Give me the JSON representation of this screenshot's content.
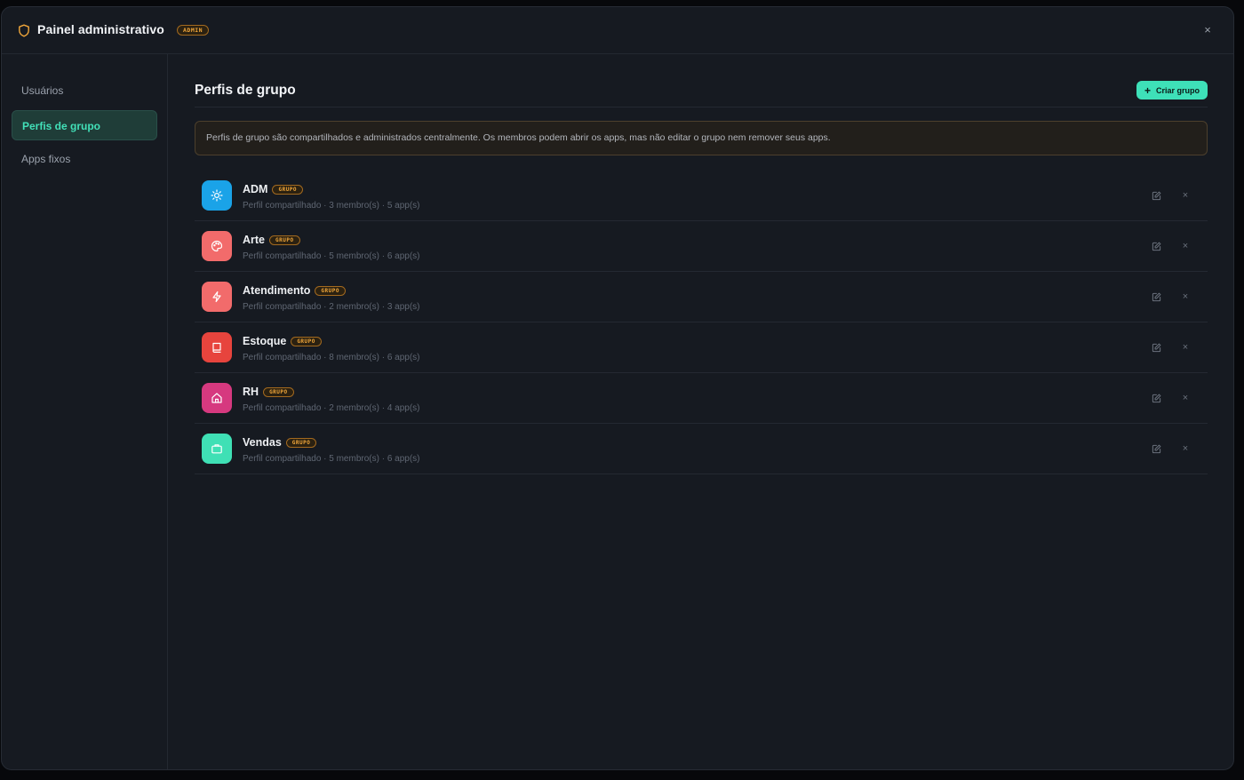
{
  "window": {
    "title": "Painel administrativo",
    "badge": "ADMIN",
    "close_symbol": "×"
  },
  "sidebar": {
    "items": [
      {
        "label": "Usuários",
        "active": false
      },
      {
        "label": "Perfis de grupo",
        "active": true
      },
      {
        "label": "Apps fixos",
        "active": false
      }
    ]
  },
  "main": {
    "title": "Perfis de grupo",
    "create_button": {
      "icon": "+",
      "label": "Criar grupo"
    },
    "info": "Perfis de grupo são compartilhados e administrados centralmente. Os membros podem abrir os apps, mas não editar o grupo nem remover seus apps.",
    "groups": [
      {
        "name": "ADM",
        "badge": "GRUPO",
        "meta": "Perfil compartilhado · 3 membro(s) · 5 app(s)",
        "icon": "sun-icon",
        "color": "#1aa3e8"
      },
      {
        "name": "Arte",
        "badge": "GRUPO",
        "meta": "Perfil compartilhado · 5 membro(s) · 6 app(s)",
        "icon": "palette-icon",
        "color": "#f26b6b"
      },
      {
        "name": "Atendimento",
        "badge": "GRUPO",
        "meta": "Perfil compartilhado · 2 membro(s) · 3 app(s)",
        "icon": "lightning-icon",
        "color": "#f26b6b"
      },
      {
        "name": "Estoque",
        "badge": "GRUPO",
        "meta": "Perfil compartilhado · 8 membro(s) · 6 app(s)",
        "icon": "book-icon",
        "color": "#e7443d"
      },
      {
        "name": "RH",
        "badge": "GRUPO",
        "meta": "Perfil compartilhado · 2 membro(s) · 4 app(s)",
        "icon": "home-icon",
        "color": "#d6397f"
      },
      {
        "name": "Vendas",
        "badge": "GRUPO",
        "meta": "Perfil compartilhado · 5 membro(s) · 6 app(s)",
        "icon": "briefcase-icon",
        "color": "#3fe0b5"
      }
    ],
    "row_remove_symbol": "×"
  },
  "colors": {
    "accent": "#3ee0b8",
    "badge": "#f0a63a",
    "background": "#161a21"
  }
}
